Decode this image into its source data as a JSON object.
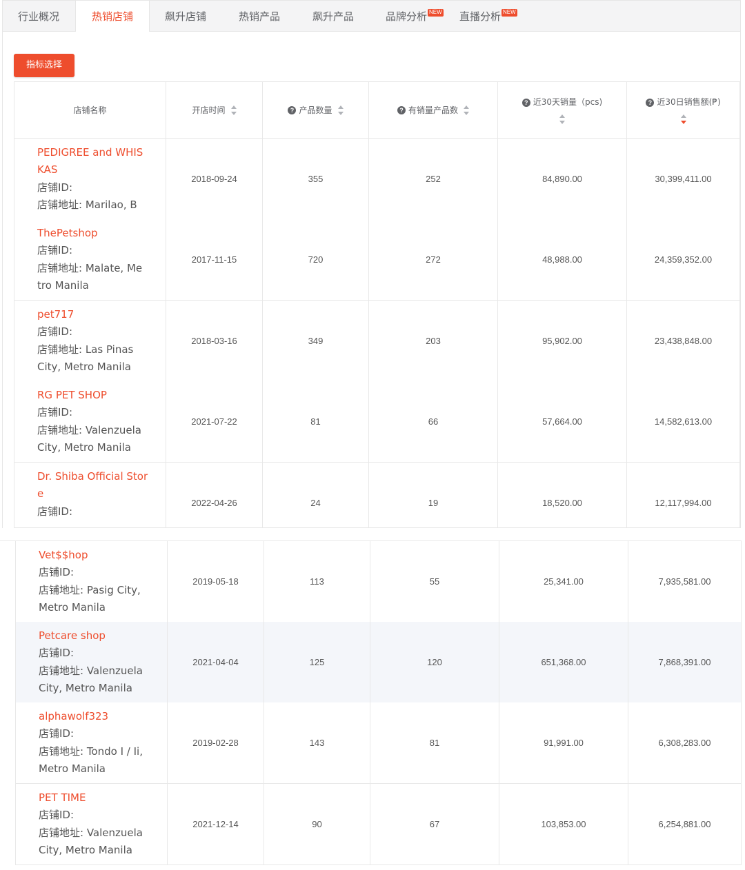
{
  "tabs": [
    {
      "label": "行业概况",
      "new": false
    },
    {
      "label": "热销店铺",
      "new": false
    },
    {
      "label": "飙升店铺",
      "new": false
    },
    {
      "label": "热销产品",
      "new": false
    },
    {
      "label": "飙升产品",
      "new": false
    },
    {
      "label": "品牌分析",
      "new": true
    },
    {
      "label": "直播分析",
      "new": true
    }
  ],
  "new_badge": "NEW",
  "active_tab": "热销店铺",
  "metric_button": "指标选择",
  "columns": {
    "store_name": "店铺名称",
    "open_time": "开店时间",
    "product_count": "产品数量",
    "sold_product_count": "有销量产品数",
    "sales_30d": "近30天销量（pcs)",
    "revenue_30d": "近30日销售额(₱)"
  },
  "labels": {
    "store_id": "店铺ID:",
    "store_address": "店铺地址:"
  },
  "rows": [
    {
      "name_lines": [
        "PEDIGREE and WHIS",
        "KAS"
      ],
      "id_line": "店铺ID:",
      "addr_lines": [
        "店铺地址:  Marilao, B"
      ],
      "open": "2018-09-24",
      "products": "355",
      "sold": "252",
      "sales": "84,890.00",
      "revenue": "30,399,411.00"
    },
    {
      "name_lines": [
        "ThePetshop"
      ],
      "id_line": "店铺ID:",
      "addr_lines": [
        "店铺地址:  Malate, Me",
        "tro Manila"
      ],
      "open": "2017-11-15",
      "products": "720",
      "sold": "272",
      "sales": "48,988.00",
      "revenue": "24,359,352.00"
    },
    {
      "name_lines": [
        "pet717"
      ],
      "id_line": "店铺ID:",
      "addr_lines": [
        "店铺地址:  Las Pinas",
        "City, Metro Manila"
      ],
      "open": "2018-03-16",
      "products": "349",
      "sold": "203",
      "sales": "95,902.00",
      "revenue": "23,438,848.00"
    },
    {
      "name_lines": [
        "RG PET SHOP"
      ],
      "id_line": "店铺ID:",
      "addr_lines": [
        "店铺地址:  Valenzuela",
        "City, Metro Manila"
      ],
      "open": "2021-07-22",
      "products": "81",
      "sold": "66",
      "sales": "57,664.00",
      "revenue": "14,582,613.00"
    },
    {
      "name_lines": [
        "Dr. Shiba Official Stor",
        "e"
      ],
      "id_line": "店铺ID:",
      "addr_lines": [],
      "open": "2022-04-26",
      "products": "24",
      "sold": "19",
      "sales": "18,520.00",
      "revenue": "12,117,994.00"
    },
    {
      "name_lines": [
        "Vet$$hop"
      ],
      "id_line": "店铺ID:",
      "addr_lines": [
        "店铺地址:  Pasig City,",
        "Metro Manila"
      ],
      "open": "2019-05-18",
      "products": "113",
      "sold": "55",
      "sales": "25,341.00",
      "revenue": "7,935,581.00"
    },
    {
      "name_lines": [
        "Petcare shop"
      ],
      "id_line": "店铺ID:",
      "addr_lines": [
        "店铺地址:  Valenzuela",
        "City, Metro Manila"
      ],
      "open": "2021-04-04",
      "products": "125",
      "sold": "120",
      "sales": "651,368.00",
      "revenue": "7,868,391.00"
    },
    {
      "name_lines": [
        "alphawolf323"
      ],
      "id_line": "店铺ID:",
      "addr_lines": [
        "店铺地址:  Tondo I / Ii,",
        "Metro Manila"
      ],
      "open": "2019-02-28",
      "products": "143",
      "sold": "81",
      "sales": "91,991.00",
      "revenue": "6,308,283.00"
    },
    {
      "name_lines": [
        "PET TIME"
      ],
      "id_line": "店铺ID:",
      "addr_lines": [
        "店铺地址:  Valenzuela",
        "City, Metro Manila"
      ],
      "open": "2021-12-14",
      "products": "90",
      "sold": "67",
      "sales": "103,853.00",
      "revenue": "6,254,881.00"
    }
  ],
  "colors": {
    "accent": "#ee4d2d",
    "highlight_row": "#f4f6fa"
  }
}
